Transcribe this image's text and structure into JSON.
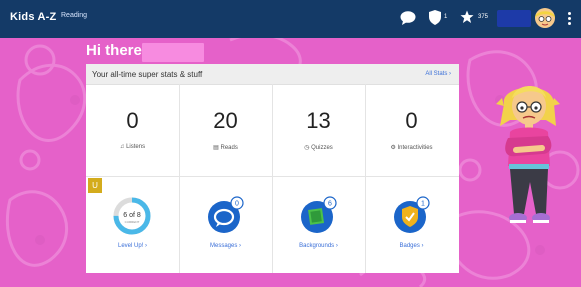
{
  "topbar": {
    "brand": "Kids A-Z",
    "section": "Reading",
    "shield_count": "1",
    "star_count": "375"
  },
  "greeting": "Hi there,",
  "card": {
    "title": "Your all-time super stats & stuff",
    "all_stats_link": "All Stats ›"
  },
  "stats": [
    {
      "value": "0",
      "label": "Listens"
    },
    {
      "value": "20",
      "label": "Reads"
    },
    {
      "value": "13",
      "label": "Quizzes"
    },
    {
      "value": "0",
      "label": "Interactivities"
    }
  ],
  "level": {
    "badge": "U",
    "progress_text": "6 of 8",
    "progress_sub": "CURRENT",
    "link": "Level Up! ›"
  },
  "links": [
    {
      "label": "Messages ›",
      "count": "0"
    },
    {
      "label": "Backgrounds ›",
      "count": "6"
    },
    {
      "label": "Badges ›",
      "count": "1"
    }
  ],
  "colors": {
    "background": "#e561c9",
    "topbar": "#143a67",
    "link": "#3a6fd8",
    "accent_blue": "#1b65c9"
  }
}
